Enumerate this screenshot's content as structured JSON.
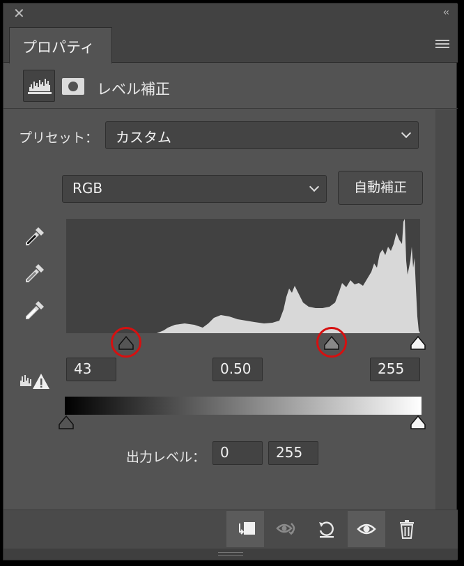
{
  "window": {
    "close_icon": "close-icon",
    "collapse_icon": "double-chevron-left-icon"
  },
  "tab": {
    "label": "プロパティ"
  },
  "panel_menu_icon": "hamburger-menu-icon",
  "adjustment": {
    "title": "レベル補正",
    "type_icon": "levels-histogram-icon",
    "mask_icon": "layer-mask-icon"
  },
  "preset": {
    "label": "プリセット：",
    "value": "カスタム"
  },
  "channel": {
    "value": "RGB"
  },
  "auto_button": {
    "label": "自動補正"
  },
  "eyedroppers": [
    "black-point-eyedropper-icon",
    "gray-point-eyedropper-icon",
    "white-point-eyedropper-icon"
  ],
  "input_levels": {
    "shadow": "43",
    "midtone": "0.50",
    "highlight": "255"
  },
  "output_levels": {
    "label": "出力レベル：",
    "low": "0",
    "high": "255"
  },
  "highlights": {
    "ring_color": "#d61010",
    "marked_sliders": [
      "input-shadow-slider",
      "input-midtone-slider"
    ]
  },
  "footer_icons": [
    "clip-to-layer-icon",
    "view-previous-state-icon",
    "reset-icon",
    "toggle-visibility-icon",
    "delete-icon"
  ]
}
